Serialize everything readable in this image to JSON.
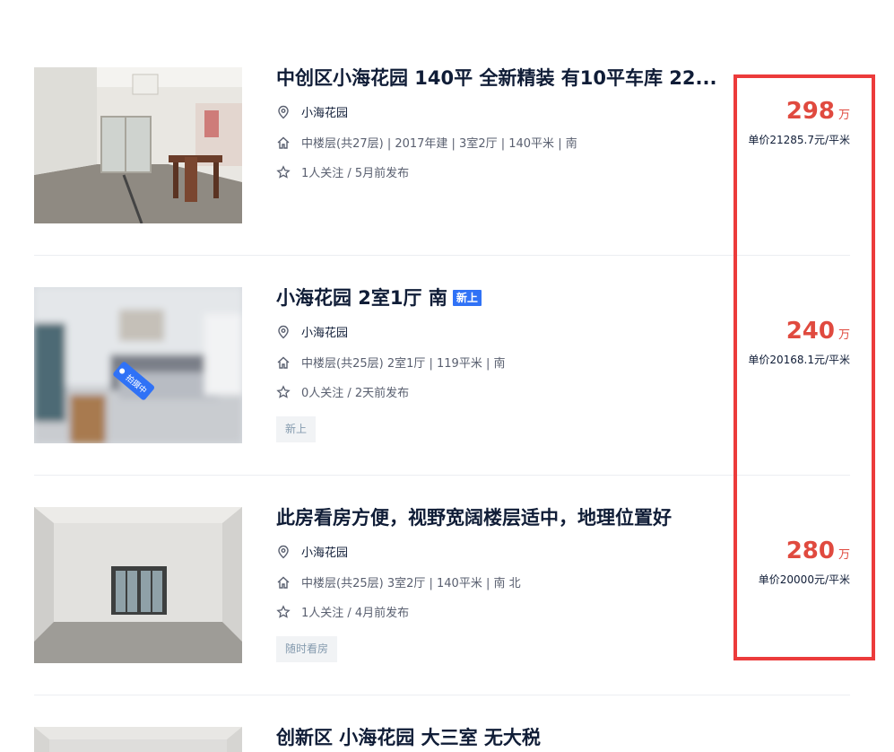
{
  "listings": [
    {
      "title": "中创区小海花园 140平 全新精装 有10平车库 22...",
      "community": "小海花园",
      "house_info": "中楼层(共27层) | 2017年建 | 3室2厅 | 140平米 | 南",
      "follow_info": "1人关注 / 5月前发布",
      "badge": "",
      "tag": "",
      "total_price": "298",
      "price_unit": "万",
      "unit_price": "单价21285.7元/平米"
    },
    {
      "title": "小海花园 2室1厅 南",
      "community": "小海花园",
      "house_info": "中楼层(共25层) 2室1厅 | 119平米 | 南",
      "follow_info": "0人关注 / 2天前发布",
      "badge": "新上",
      "tag": "新上",
      "photo_label": "拍摄中",
      "total_price": "240",
      "price_unit": "万",
      "unit_price": "单价20168.1元/平米"
    },
    {
      "title": "此房看房方便，视野宽阔楼层适中，地理位置好",
      "community": "小海花园",
      "house_info": "中楼层(共25层) 3室2厅 | 140平米 | 南 北",
      "follow_info": "1人关注 / 4月前发布",
      "badge": "",
      "tag": "随时看房",
      "total_price": "280",
      "price_unit": "万",
      "unit_price": "单价20000元/平米"
    },
    {
      "title": "创新区 小海花园 大三室 无大税"
    }
  ],
  "icons": {
    "location": "location-pin-icon",
    "house": "house-icon",
    "follow": "star-icon"
  },
  "colors": {
    "price": "#e04a3f",
    "badge": "#3072f6",
    "highlight": "#ec3b3b",
    "title": "#101d37"
  }
}
